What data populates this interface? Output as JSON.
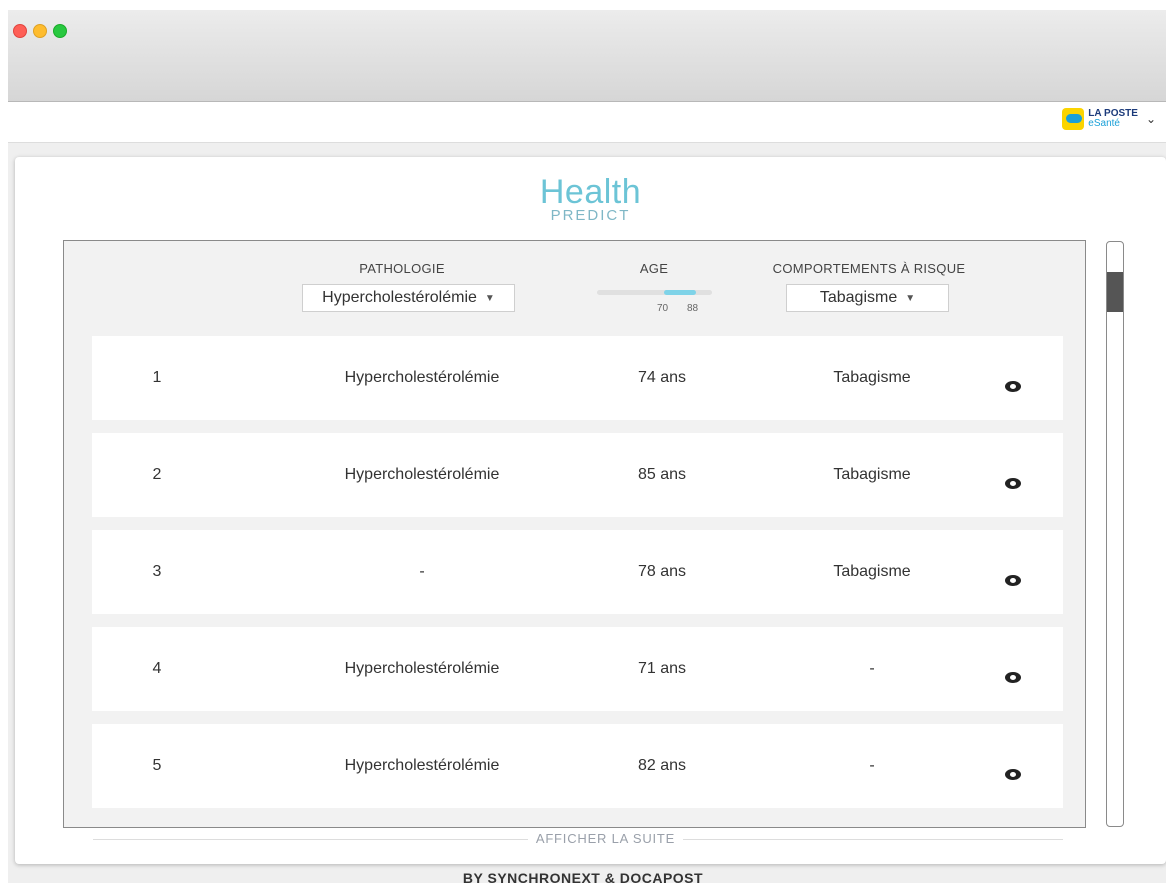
{
  "brand": {
    "line1": "LA POSTE",
    "line2": "eSanté"
  },
  "logo": {
    "health": "Health",
    "predict": "PREDICT"
  },
  "filters": {
    "pathologie_label": "PATHOLOGIE",
    "pathologie_value": "Hypercholestérolémie",
    "age_label": "AGE",
    "age_min": "70",
    "age_max": "88",
    "risque_label": "COMPORTEMENTS À RISQUE",
    "risque_value": "Tabagisme"
  },
  "rows": [
    {
      "num": "1",
      "pathologie": "Hypercholestérolémie",
      "age": "74 ans",
      "risque": "Tabagisme"
    },
    {
      "num": "2",
      "pathologie": "Hypercholestérolémie",
      "age": "85 ans",
      "risque": "Tabagisme"
    },
    {
      "num": "3",
      "pathologie": "-",
      "age": "78 ans",
      "risque": "Tabagisme"
    },
    {
      "num": "4",
      "pathologie": "Hypercholestérolémie",
      "age": "71 ans",
      "risque": "-"
    },
    {
      "num": "5",
      "pathologie": "Hypercholestérolémie",
      "age": "82 ans",
      "risque": "-"
    }
  ],
  "more_label": "AFFICHER LA SUITE",
  "footer": "BY SYNCHRONEXT & DOCAPOST"
}
